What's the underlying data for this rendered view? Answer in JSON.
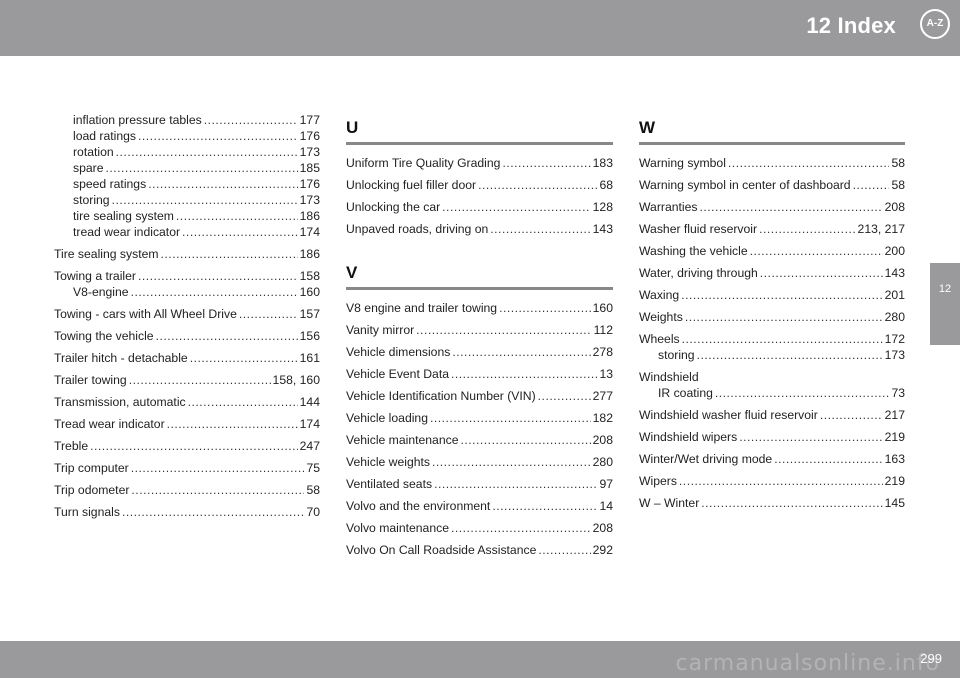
{
  "header": {
    "title": "12 Index",
    "icon_label": "A-Z"
  },
  "side_tab": {
    "label": "12"
  },
  "footer": {
    "page_number": "299",
    "watermark": "carmanualsonline.info"
  },
  "col1": {
    "entries": [
      {
        "text": "inflation pressure tables",
        "page": "177",
        "sub": true
      },
      {
        "text": "load ratings",
        "page": "176",
        "sub": true
      },
      {
        "text": "rotation",
        "page": "173",
        "sub": true
      },
      {
        "text": "spare",
        "page": "185",
        "sub": true
      },
      {
        "text": "speed ratings",
        "page": "176",
        "sub": true
      },
      {
        "text": "storing",
        "page": "173",
        "sub": true
      },
      {
        "text": "tire sealing system",
        "page": "186",
        "sub": true
      },
      {
        "text": "tread wear indicator",
        "page": "174",
        "sub": true
      },
      {
        "text": "Tire sealing system",
        "page": "186"
      },
      {
        "text": "Towing a trailer",
        "page": "158"
      },
      {
        "text": "V8-engine",
        "page": "160",
        "sub": true
      },
      {
        "text": "Towing - cars with All Wheel Drive",
        "page": "157"
      },
      {
        "text": "Towing the vehicle",
        "page": "156"
      },
      {
        "text": "Trailer hitch - detachable",
        "page": "161"
      },
      {
        "text": "Trailer towing",
        "page": "158, 160"
      },
      {
        "text": "Transmission, automatic",
        "page": "144"
      },
      {
        "text": "Tread wear indicator",
        "page": "174"
      },
      {
        "text": "Treble",
        "page": "247"
      },
      {
        "text": "Trip computer",
        "page": "75"
      },
      {
        "text": "Trip odometer",
        "page": "58"
      },
      {
        "text": "Turn signals",
        "page": "70"
      }
    ]
  },
  "col2": {
    "section_u": {
      "letter": "U",
      "entries": [
        {
          "text": "Uniform Tire Quality Grading",
          "page": "183"
        },
        {
          "text": "Unlocking fuel filler door",
          "page": "68"
        },
        {
          "text": "Unlocking the car",
          "page": "128"
        },
        {
          "text": "Unpaved roads, driving on",
          "page": "143"
        }
      ]
    },
    "section_v": {
      "letter": "V",
      "entries": [
        {
          "text": "V8 engine and trailer towing",
          "page": "160"
        },
        {
          "text": "Vanity mirror",
          "page": "112"
        },
        {
          "text": "Vehicle dimensions",
          "page": "278"
        },
        {
          "text": "Vehicle Event Data",
          "page": "13"
        },
        {
          "text": "Vehicle Identification Number (VIN)",
          "page": "277"
        },
        {
          "text": "Vehicle loading",
          "page": "182"
        },
        {
          "text": "Vehicle maintenance",
          "page": "208"
        },
        {
          "text": "Vehicle weights",
          "page": "280"
        },
        {
          "text": "Ventilated seats",
          "page": "97"
        },
        {
          "text": "Volvo and the environment",
          "page": "14"
        },
        {
          "text": "Volvo maintenance",
          "page": "208"
        },
        {
          "text": "Volvo On Call Roadside Assistance",
          "page": "292"
        }
      ]
    }
  },
  "col3": {
    "section_w": {
      "letter": "W",
      "entries": [
        {
          "text": "Warning symbol",
          "page": "58"
        },
        {
          "text": "Warning symbol in center of dashboard",
          "page": "58"
        },
        {
          "text": "Warranties",
          "page": "208"
        },
        {
          "text": "Washer fluid reservoir",
          "page": "213, 217"
        },
        {
          "text": "Washing the vehicle",
          "page": "200"
        },
        {
          "text": "Water, driving through",
          "page": "143"
        },
        {
          "text": "Waxing",
          "page": "201"
        },
        {
          "text": "Weights",
          "page": "280"
        },
        {
          "text": "Wheels",
          "page": "172"
        },
        {
          "text": "storing",
          "page": "173",
          "sub": true
        }
      ],
      "windshield_heading": "Windshield",
      "entries_after": [
        {
          "text": "IR coating",
          "page": "73",
          "sub": true
        },
        {
          "text": "Windshield washer fluid reservoir",
          "page": "217"
        },
        {
          "text": "Windshield wipers",
          "page": "219"
        },
        {
          "text": "Winter/Wet driving mode",
          "page": "163"
        },
        {
          "text": "Wipers",
          "page": "219"
        },
        {
          "text": "W – Winter",
          "page": "145"
        }
      ]
    }
  }
}
